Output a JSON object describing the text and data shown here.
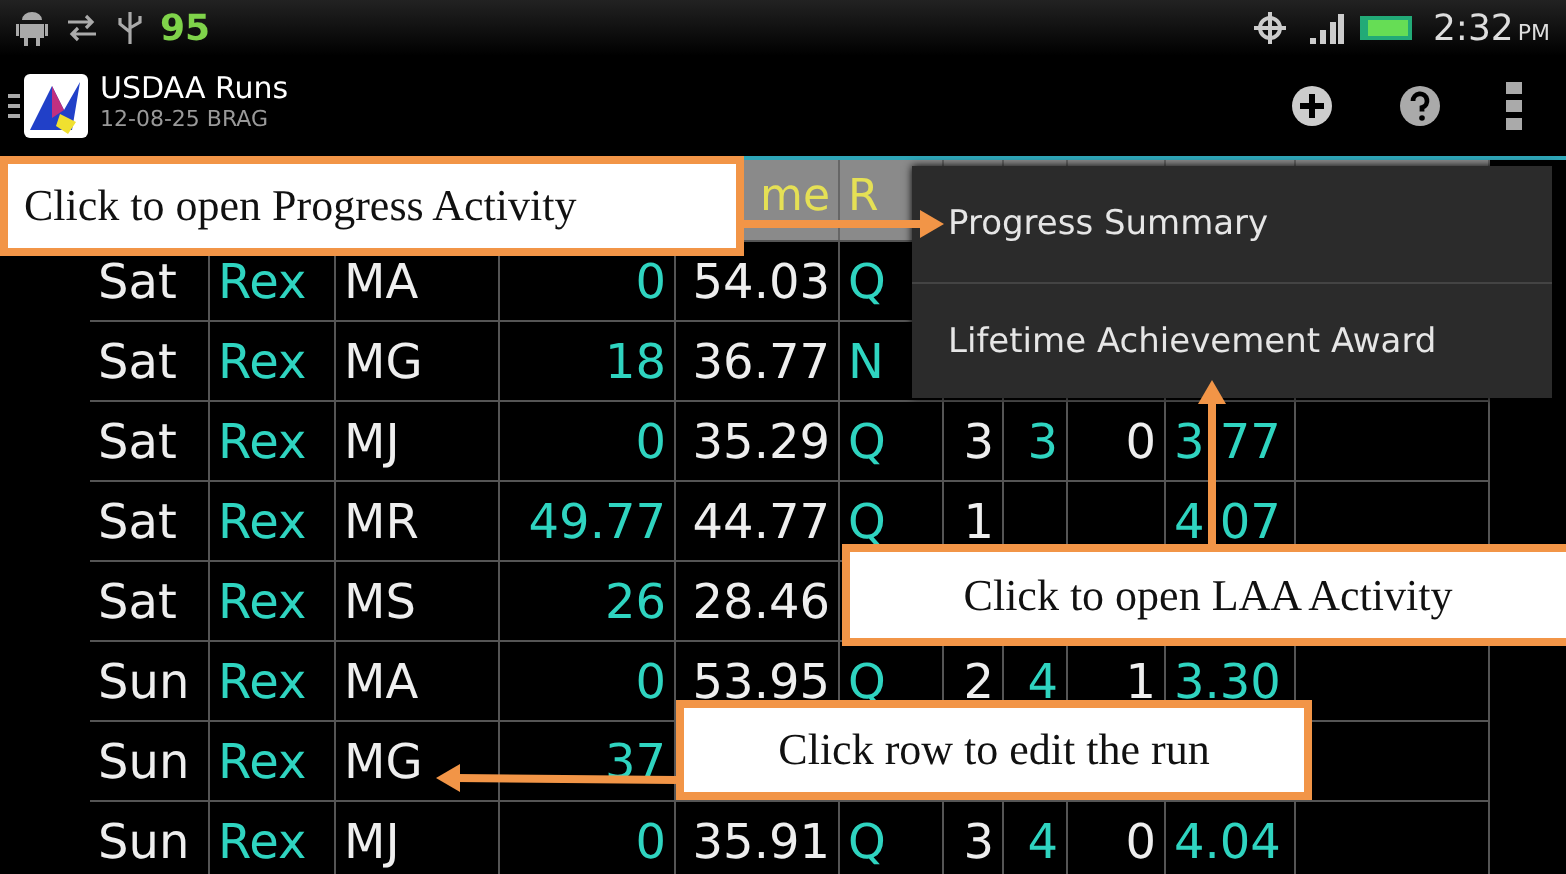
{
  "status_bar": {
    "battery_level_text": "95",
    "time": "2:32",
    "time_suffix": "PM"
  },
  "action_bar": {
    "title": "USDAA Runs",
    "subtitle": "12-08-25 BRAG"
  },
  "table": {
    "header": [
      {
        "label": "me"
      },
      {
        "label": "R"
      }
    ],
    "rows": [
      [
        "Sat",
        "Rex",
        "MA",
        "0",
        "54.03",
        "Q"
      ],
      [
        "Sat",
        "Rex",
        "MG",
        "18",
        "36.77",
        "N"
      ],
      [
        "Sat",
        "Rex",
        "MJ",
        "0",
        "35.29",
        "Q",
        "3",
        "3",
        "0",
        "3.77"
      ],
      [
        "Sat",
        "Rex",
        "MR",
        "49.77",
        "44.77",
        "Q",
        "1",
        null,
        null,
        "4.07"
      ],
      [
        "Sat",
        "Rex",
        "MS",
        "26",
        "28.46"
      ],
      [
        "Sun",
        "Rex",
        "MA",
        "0",
        "53.95",
        "Q",
        "2",
        "4",
        "1",
        "3.30"
      ],
      [
        "Sun",
        "Rex",
        "MG",
        "37"
      ],
      [
        "Sun",
        "Rex",
        "MJ",
        "0",
        "35.91",
        "Q",
        "3",
        "4",
        "0",
        "4.04"
      ]
    ]
  },
  "menu": {
    "items": [
      {
        "label": "Progress Summary"
      },
      {
        "label": "Lifetime Achievement Award"
      }
    ]
  },
  "callouts": [
    {
      "text": "Click to open Progress Activity"
    },
    {
      "text": "Click to open LAA Activity"
    },
    {
      "text": "Click row to edit the run"
    }
  ]
}
